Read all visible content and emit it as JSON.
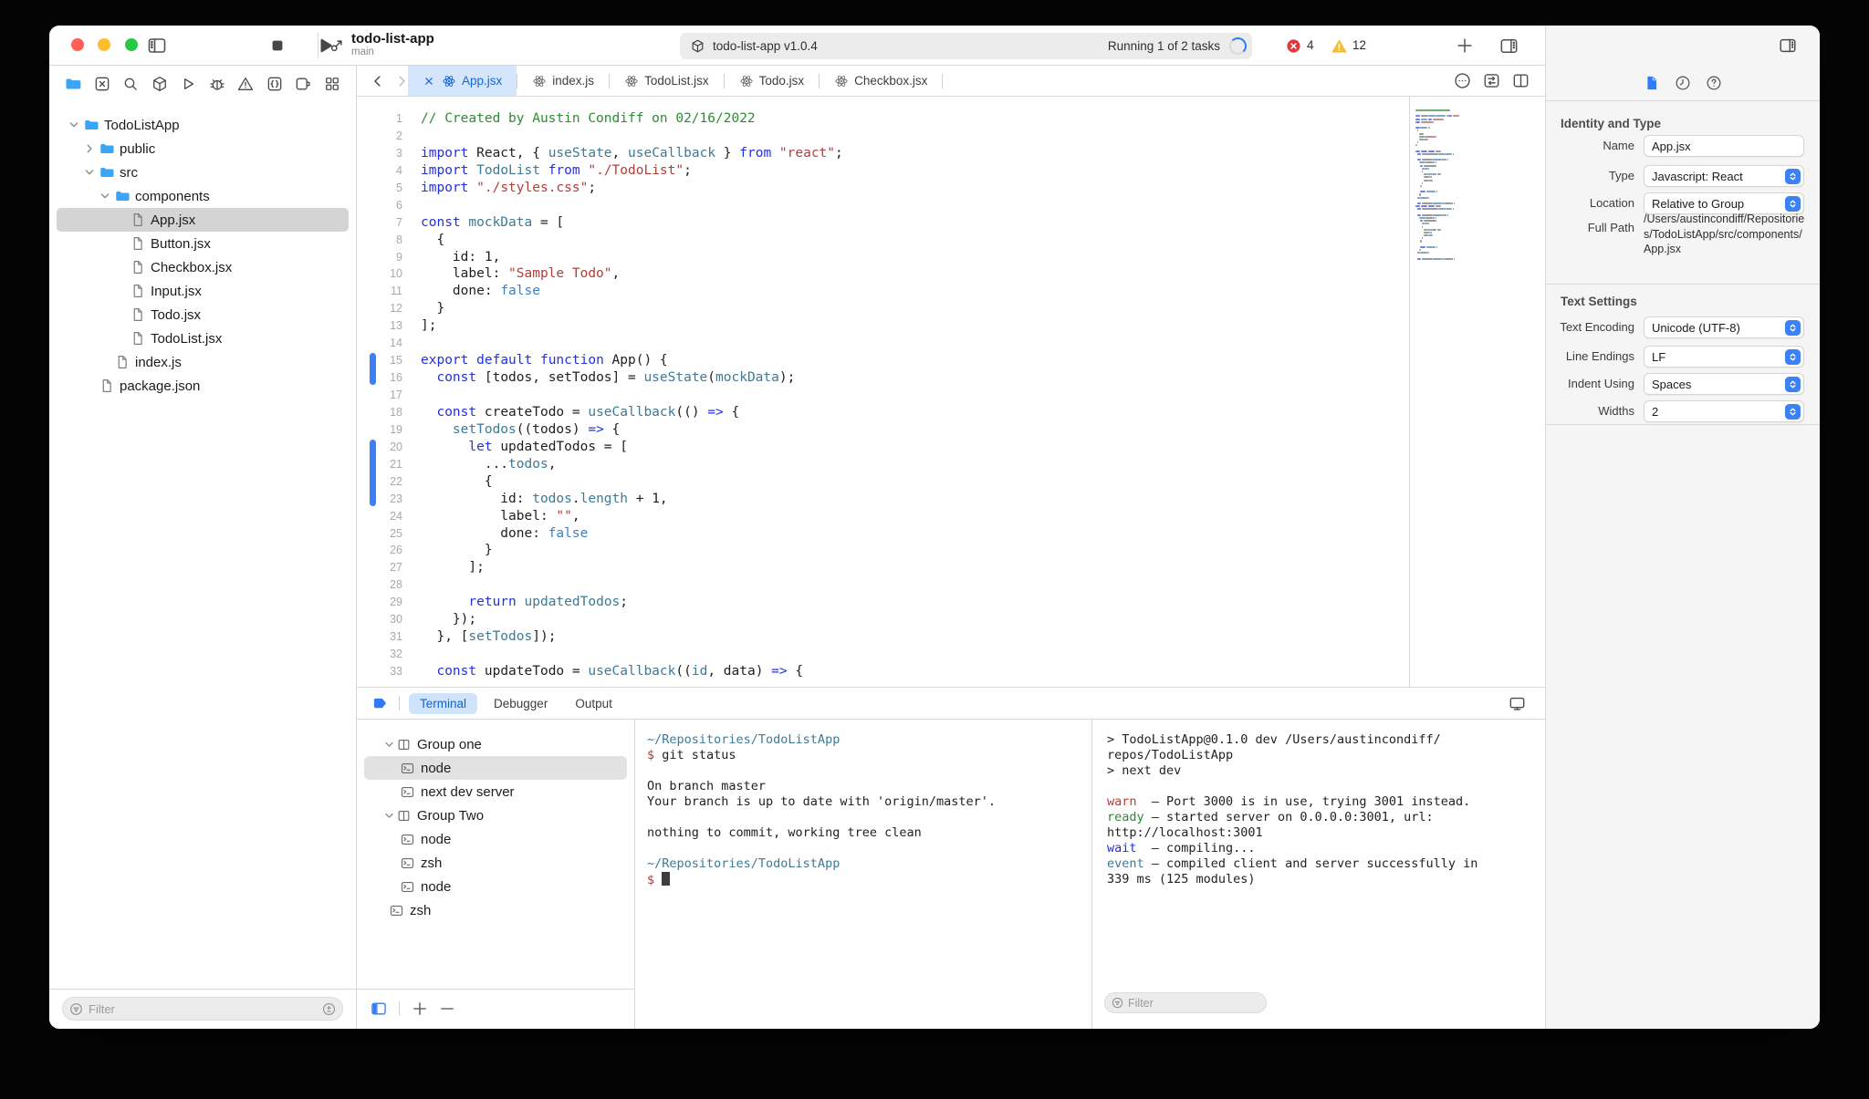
{
  "window": {
    "project": "todo-list-app",
    "branch": "main"
  },
  "toolbar": {
    "status_app": "todo-list-app v1.0.4",
    "status_tasks": "Running 1 of 2 tasks",
    "error_count": "4",
    "warning_count": "12"
  },
  "activity_icons": [
    "folder",
    "x-square",
    "search",
    "cube",
    "play",
    "bug",
    "warning",
    "braces",
    "plug",
    "grid"
  ],
  "sidebar": {
    "filter_placeholder": "Filter",
    "tree": [
      {
        "label": "TodoListApp",
        "level": 0,
        "type": "folder",
        "chev": "down"
      },
      {
        "label": "public",
        "level": 1,
        "type": "folder",
        "chev": "right"
      },
      {
        "label": "src",
        "level": 1,
        "type": "folder",
        "chev": "down"
      },
      {
        "label": "components",
        "level": 2,
        "type": "folder",
        "chev": "down"
      },
      {
        "label": "App.jsx",
        "level": 3,
        "type": "file",
        "selected": true
      },
      {
        "label": "Button.jsx",
        "level": 3,
        "type": "file"
      },
      {
        "label": "Checkbox.jsx",
        "level": 3,
        "type": "file"
      },
      {
        "label": "Input.jsx",
        "level": 3,
        "type": "file"
      },
      {
        "label": "Todo.jsx",
        "level": 3,
        "type": "file"
      },
      {
        "label": "TodoList.jsx",
        "level": 3,
        "type": "file"
      },
      {
        "label": "index.js",
        "level": 2,
        "type": "file"
      },
      {
        "label": "package.json",
        "level": 1,
        "type": "file"
      }
    ]
  },
  "editor_tabs": [
    {
      "label": "App.jsx",
      "active": true
    },
    {
      "label": "index.js"
    },
    {
      "label": "TodoList.jsx"
    },
    {
      "label": "Todo.jsx"
    },
    {
      "label": "Checkbox.jsx"
    }
  ],
  "code": {
    "changed_ranges": [
      [
        15,
        16
      ],
      [
        20,
        23
      ]
    ],
    "lines": [
      {
        "n": 1,
        "t": [
          [
            "c",
            "// Created by Austin Condiff on 02/16/2022"
          ]
        ]
      },
      {
        "n": 2,
        "t": []
      },
      {
        "n": 3,
        "t": [
          [
            "k",
            "import"
          ],
          [
            "p",
            " React, { "
          ],
          [
            "t",
            "useState"
          ],
          [
            "p",
            ", "
          ],
          [
            "t",
            "useCallback"
          ],
          [
            "p",
            " } "
          ],
          [
            "k",
            "from"
          ],
          [
            "p",
            " "
          ],
          [
            "s",
            "\"react\""
          ],
          [
            "p",
            ";"
          ]
        ]
      },
      {
        "n": 4,
        "t": [
          [
            "k",
            "import"
          ],
          [
            "p",
            " "
          ],
          [
            "t",
            "TodoList"
          ],
          [
            "p",
            " "
          ],
          [
            "k",
            "from"
          ],
          [
            "p",
            " "
          ],
          [
            "s",
            "\"./TodoList\""
          ],
          [
            "p",
            ";"
          ]
        ]
      },
      {
        "n": 5,
        "t": [
          [
            "k",
            "import"
          ],
          [
            "p",
            " "
          ],
          [
            "s",
            "\"./styles.css\""
          ],
          [
            "p",
            ";"
          ]
        ]
      },
      {
        "n": 6,
        "t": []
      },
      {
        "n": 7,
        "t": [
          [
            "k",
            "const"
          ],
          [
            "p",
            " "
          ],
          [
            "t",
            "mockData"
          ],
          [
            "p",
            " = ["
          ]
        ]
      },
      {
        "n": 8,
        "t": [
          [
            "p",
            "  {"
          ]
        ]
      },
      {
        "n": 9,
        "t": [
          [
            "p",
            "    id: 1,"
          ]
        ]
      },
      {
        "n": 10,
        "t": [
          [
            "p",
            "    label: "
          ],
          [
            "s",
            "\"Sample Todo\""
          ],
          [
            "p",
            ","
          ]
        ]
      },
      {
        "n": 11,
        "t": [
          [
            "p",
            "    done: "
          ],
          [
            "v",
            "false"
          ]
        ]
      },
      {
        "n": 12,
        "t": [
          [
            "p",
            "  }"
          ]
        ]
      },
      {
        "n": 13,
        "t": [
          [
            "p",
            "];"
          ]
        ]
      },
      {
        "n": 14,
        "t": []
      },
      {
        "n": 15,
        "t": [
          [
            "k",
            "export"
          ],
          [
            "p",
            " "
          ],
          [
            "k",
            "default"
          ],
          [
            "p",
            " "
          ],
          [
            "k",
            "function"
          ],
          [
            "p",
            " App() {"
          ]
        ]
      },
      {
        "n": 16,
        "t": [
          [
            "p",
            "  "
          ],
          [
            "k",
            "const"
          ],
          [
            "p",
            " [todos, setTodos] = "
          ],
          [
            "t",
            "useState"
          ],
          [
            "p",
            "("
          ],
          [
            "t",
            "mockData"
          ],
          [
            "p",
            ");"
          ]
        ]
      },
      {
        "n": 17,
        "t": []
      },
      {
        "n": 18,
        "t": [
          [
            "p",
            "  "
          ],
          [
            "k",
            "const"
          ],
          [
            "p",
            " createTodo = "
          ],
          [
            "t",
            "useCallback"
          ],
          [
            "p",
            "(() "
          ],
          [
            "k",
            "=>"
          ],
          [
            "p",
            " {"
          ]
        ]
      },
      {
        "n": 19,
        "t": [
          [
            "p",
            "    "
          ],
          [
            "t",
            "setTodos"
          ],
          [
            "p",
            "((todos) "
          ],
          [
            "k",
            "=>"
          ],
          [
            "p",
            " {"
          ]
        ]
      },
      {
        "n": 20,
        "t": [
          [
            "p",
            "      "
          ],
          [
            "k",
            "let"
          ],
          [
            "p",
            " updatedTodos = ["
          ]
        ]
      },
      {
        "n": 21,
        "t": [
          [
            "p",
            "        ..."
          ],
          [
            "t",
            "todos"
          ],
          [
            "p",
            ","
          ]
        ]
      },
      {
        "n": 22,
        "t": [
          [
            "p",
            "        {"
          ]
        ]
      },
      {
        "n": 23,
        "t": [
          [
            "p",
            "          id: "
          ],
          [
            "t",
            "todos"
          ],
          [
            "p",
            "."
          ],
          [
            "t",
            "length"
          ],
          [
            "p",
            " + 1,"
          ]
        ]
      },
      {
        "n": 24,
        "t": [
          [
            "p",
            "          label: "
          ],
          [
            "s",
            "\"\""
          ],
          [
            "p",
            ","
          ]
        ]
      },
      {
        "n": 25,
        "t": [
          [
            "p",
            "          done: "
          ],
          [
            "v",
            "false"
          ]
        ]
      },
      {
        "n": 26,
        "t": [
          [
            "p",
            "        }"
          ]
        ]
      },
      {
        "n": 27,
        "t": [
          [
            "p",
            "      ];"
          ]
        ]
      },
      {
        "n": 28,
        "t": []
      },
      {
        "n": 29,
        "t": [
          [
            "p",
            "      "
          ],
          [
            "k",
            "return"
          ],
          [
            "p",
            " "
          ],
          [
            "t",
            "updatedTodos"
          ],
          [
            "p",
            ";"
          ]
        ]
      },
      {
        "n": 30,
        "t": [
          [
            "p",
            "    });"
          ]
        ]
      },
      {
        "n": 31,
        "t": [
          [
            "p",
            "  }, ["
          ],
          [
            "t",
            "setTodos"
          ],
          [
            "p",
            "]);"
          ]
        ]
      },
      {
        "n": 32,
        "t": []
      },
      {
        "n": 33,
        "t": [
          [
            "p",
            "  "
          ],
          [
            "k",
            "const"
          ],
          [
            "p",
            " updateTodo = "
          ],
          [
            "t",
            "useCallback"
          ],
          [
            "p",
            "(("
          ],
          [
            "t",
            "id"
          ],
          [
            "p",
            ", data) "
          ],
          [
            "k",
            "=>"
          ],
          [
            "p",
            " {"
          ]
        ]
      }
    ]
  },
  "terminal": {
    "tabs": [
      {
        "label": "Terminal",
        "active": true
      },
      {
        "label": "Debugger"
      },
      {
        "label": "Output"
      }
    ],
    "groups": [
      {
        "label": "Group one",
        "icon": "group",
        "chev": true,
        "indent": 20
      },
      {
        "label": "node",
        "icon": "term",
        "indent": 39,
        "selected": true
      },
      {
        "label": "next dev server",
        "icon": "term",
        "indent": 39
      },
      {
        "label": "Group Two",
        "icon": "group",
        "chev": true,
        "indent": 20
      },
      {
        "label": "node",
        "icon": "term",
        "indent": 39
      },
      {
        "label": "zsh",
        "icon": "term",
        "indent": 39
      },
      {
        "label": "node",
        "icon": "term",
        "indent": 39
      },
      {
        "label": "zsh",
        "icon": "term",
        "indent": 27
      }
    ],
    "pane1": [
      [
        [
          "t",
          "~/Repositories/TodoListApp"
        ]
      ],
      [
        [
          "r",
          "$"
        ],
        [
          "p",
          " git status"
        ]
      ],
      [],
      [
        [
          "p",
          "On branch master"
        ]
      ],
      [
        [
          "p",
          "Your branch is up to date with 'origin/master'."
        ]
      ],
      [],
      [
        [
          "p",
          "nothing to commit, working tree clean"
        ]
      ],
      [],
      [
        [
          "t",
          "~/Repositories/TodoListApp"
        ]
      ],
      [
        [
          "r",
          "$ "
        ],
        [
          "cur",
          ""
        ]
      ]
    ],
    "pane2": [
      [
        [
          "p",
          "> TodoListApp@0.1.0 dev /Users/austincondiff/"
        ]
      ],
      [
        [
          "p",
          "repos/TodoListApp"
        ]
      ],
      [
        [
          "p",
          "> next dev"
        ]
      ],
      [],
      [
        [
          "r",
          "warn"
        ],
        [
          "p",
          "  – Port 3000 is in use, trying 3001 instead."
        ]
      ],
      [
        [
          "g",
          "ready"
        ],
        [
          "p",
          " – started server on 0.0.0.0:3001, url:"
        ]
      ],
      [
        [
          "p",
          "http://localhost:3001"
        ]
      ],
      [
        [
          "b",
          "wait"
        ],
        [
          "p",
          "  – compiling..."
        ]
      ],
      [
        [
          "t",
          "event"
        ],
        [
          "p",
          " – compiled client and server successfully in"
        ]
      ],
      [
        [
          "p",
          "339 ms (125 modules)"
        ]
      ]
    ],
    "filter_placeholder": "Filter"
  },
  "inspector": {
    "tabs": [
      "doc-fill",
      "clock",
      "question"
    ],
    "sections": [
      {
        "title": "Identity and Type",
        "rows": [
          {
            "label": "Name",
            "type": "input",
            "value": "App.jsx"
          },
          {
            "label": "Type",
            "type": "select",
            "value": "Javascript: React"
          },
          {
            "label": "Location",
            "type": "select",
            "value": "Relative to Group"
          },
          {
            "label": "Full Path",
            "type": "path",
            "value": "/Users/austincondiff/Repositories/TodoListApp/src/components/App.jsx"
          }
        ]
      },
      {
        "title": "Text Settings",
        "rows": [
          {
            "label": "Text Encoding",
            "type": "select",
            "value": "Unicode (UTF-8)"
          },
          {
            "label": "Line Endings",
            "type": "select",
            "value": "LF"
          },
          {
            "label": "Indent Using",
            "type": "select",
            "value": "Spaces"
          },
          {
            "label": "Widths",
            "type": "select",
            "value": "2"
          }
        ]
      }
    ]
  }
}
